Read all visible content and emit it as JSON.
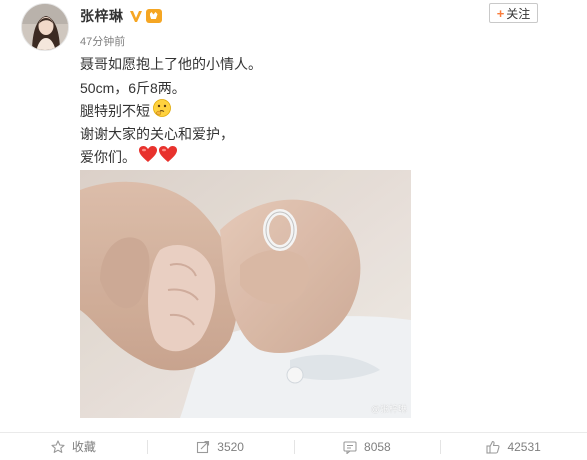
{
  "post": {
    "author_name": "张梓琳",
    "timestamp": "47分钟前",
    "follow_label": "关注",
    "text_lines": [
      "聂哥如愿抱上了他的小情人。",
      "50cm，6斤8两。",
      "腿特别不短",
      "谢谢大家的关心和爱护，",
      "爱你们。"
    ],
    "emojis": {
      "line3": "thinking-emoji",
      "line5": [
        "heart-emoji",
        "heart-emoji"
      ]
    },
    "photo": {
      "description_icon": "baby-hand-photo",
      "watermark": "@张梓琳"
    }
  },
  "actions": {
    "favorite_label": "收藏",
    "repost_count": "3520",
    "comment_count": "8058",
    "like_count": "42531"
  },
  "colors": {
    "accent_orange": "#fa7d3c",
    "vip_gold": "#f5a623",
    "verified_orange": "#f6a623",
    "heart_red": "#e8322d",
    "muted_text": "#808080"
  }
}
